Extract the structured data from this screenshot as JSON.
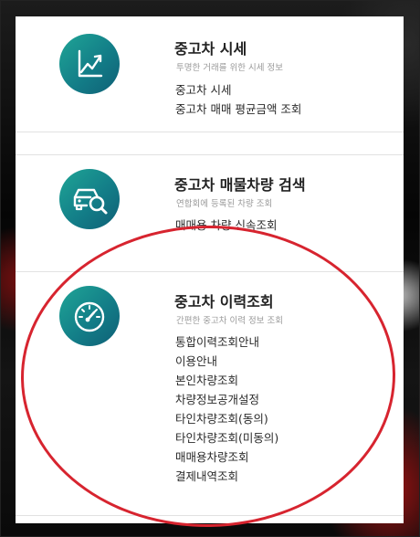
{
  "colors": {
    "icon_gradient_start": "#1fa596",
    "icon_gradient_end": "#0f5f76",
    "highlight": "#d7242f"
  },
  "sections": [
    {
      "icon": "chart-trend-icon",
      "title": "중고차 시세",
      "subtitle": "투명한 거래를 위한 시세 정보",
      "links": [
        "중고차 시세",
        "중고차 매매 평균금액 조회"
      ]
    },
    {
      "icon": "car-search-icon",
      "title": "중고차 매물차량 검색",
      "subtitle": "연합회에 등록된 차량 조회",
      "links": [
        "매매용 차량 신속조회"
      ]
    },
    {
      "icon": "speedometer-icon",
      "title": "중고차 이력조회",
      "subtitle": "간편한 중고차 이력 정보 조회",
      "links": [
        "통합이력조회안내",
        "이용안내",
        "본인차량조회",
        "차량정보공개설정",
        "타인차량조회(동의)",
        "타인차량조회(미동의)",
        "매매용차량조회",
        "결제내역조회"
      ]
    }
  ]
}
